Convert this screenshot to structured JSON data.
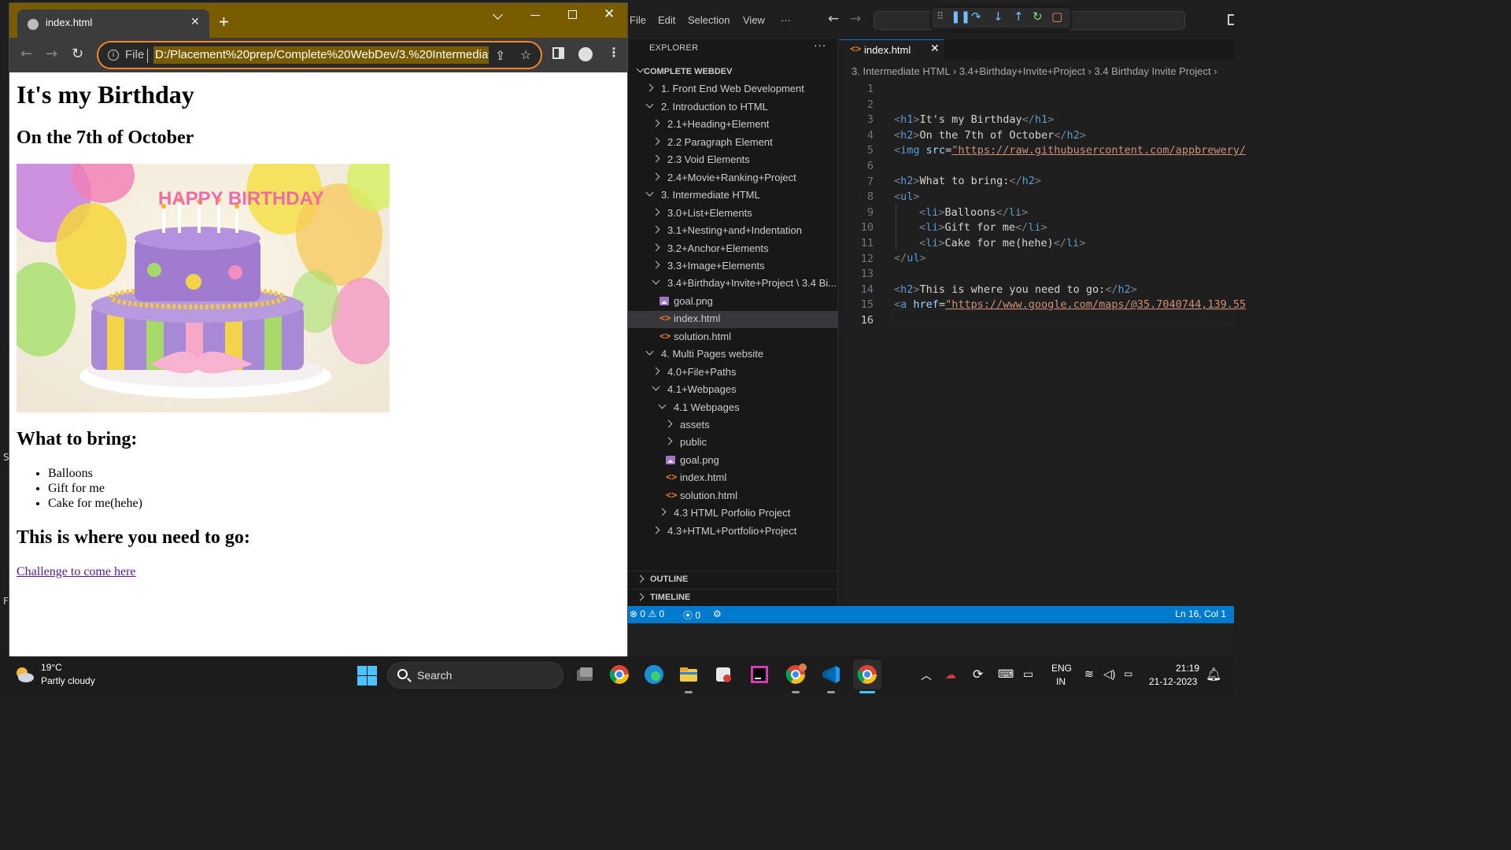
{
  "browser": {
    "tab_title": "index.html",
    "scheme_label": "File",
    "url": "D:/Placement%20prep/Complete%20WebDev/3.%20Intermediate%",
    "accent_color": "#7a5c00",
    "omnibox_focus_color": "#ef8a2c"
  },
  "page": {
    "h1": "It's my Birthday",
    "h2_date": "On the 7th of October",
    "image_alt": "birthday-cake",
    "cake_text": "HAPPY BIRTHDAY",
    "h2_bring": "What to bring:",
    "items": [
      "Balloons",
      "Gift for me",
      "Cake for me(hehe)"
    ],
    "h2_where": "This is where you need to go:",
    "link_text": "Challenge to come here"
  },
  "vscode": {
    "menu": [
      "File",
      "Edit",
      "Selection",
      "View",
      "···"
    ],
    "explorer_title": "EXPLORER",
    "workspace": "COMPLETE WEBDEV",
    "tree": [
      {
        "label": "1. Front End Web Development",
        "type": "folder",
        "open": false
      },
      {
        "label": "2. Introduction to HTML",
        "type": "folder",
        "open": true
      },
      {
        "label": "2.1+Heading+Element",
        "type": "folder",
        "open": false
      },
      {
        "label": "2.2 Paragraph Element",
        "type": "folder",
        "open": false
      },
      {
        "label": "2.3 Void Elements",
        "type": "folder",
        "open": false
      },
      {
        "label": "2.4+Movie+Ranking+Project",
        "type": "folder",
        "open": false
      },
      {
        "label": "3. Intermediate HTML",
        "type": "folder",
        "open": true
      },
      {
        "label": "3.0+List+Elements",
        "type": "folder",
        "open": false
      },
      {
        "label": "3.1+Nesting+and+Indentation",
        "type": "folder",
        "open": false
      },
      {
        "label": "3.2+Anchor+Elements",
        "type": "folder",
        "open": false
      },
      {
        "label": "3.3+Image+Elements",
        "type": "folder",
        "open": false
      },
      {
        "label": "3.4+Birthday+Invite+Project \\ 3.4 Bi...",
        "type": "folder",
        "open": true
      },
      {
        "label": "goal.png",
        "type": "image"
      },
      {
        "label": "index.html",
        "type": "html",
        "selected": true
      },
      {
        "label": "solution.html",
        "type": "html"
      },
      {
        "label": "4. Multi Pages website",
        "type": "folder",
        "open": true
      },
      {
        "label": "4.0+File+Paths",
        "type": "folder",
        "open": false
      },
      {
        "label": "4.1+Webpages",
        "type": "folder",
        "open": true
      },
      {
        "label": "4.1 Webpages",
        "type": "folder",
        "open": true
      },
      {
        "label": "assets",
        "type": "folder",
        "open": false
      },
      {
        "label": "public",
        "type": "folder",
        "open": false
      },
      {
        "label": "goal.png",
        "type": "image"
      },
      {
        "label": "index.html",
        "type": "html"
      },
      {
        "label": "solution.html",
        "type": "html"
      },
      {
        "label": "4.3 HTML Porfolio Project",
        "type": "folder",
        "open": false
      },
      {
        "label": "4.3+HTML+Portfolio+Project",
        "type": "folder",
        "open": false
      }
    ],
    "outline_label": "OUTLINE",
    "timeline_label": "TIMELINE",
    "editor_tab": "index.html",
    "breadcrumb": [
      "3. Intermediate HTML",
      "3.4+Birthday+Invite+Project",
      "3.4 Birthday Invite Project"
    ],
    "line_numbers": [
      "1",
      "2",
      "3",
      "4",
      "5",
      "6",
      "7",
      "8",
      "9",
      "10",
      "11",
      "12",
      "13",
      "14",
      "15",
      "16"
    ],
    "code": {
      "l3_text": "It's my Birthday",
      "l4_text": "On the 7th of October",
      "l5_attr": "src",
      "l5_url": "https://raw.githubusercontent.com/appbrewery/",
      "l7_text": "What to bring:",
      "l9_text": "Balloons",
      "l10_text": "Gift for me",
      "l11_text": "Cake for me(hehe)",
      "l14_text": "This is where you need to go:",
      "l15_attr": "href",
      "l15_url": "https://www.google.com/maps/@35.7040744,139.55"
    },
    "status": {
      "errors": "0",
      "warnings": "0",
      "ports": "0",
      "position": "Ln 16, Col 1"
    }
  },
  "taskbar": {
    "temperature": "19°C",
    "weather": "Partly cloudy",
    "search_label": "Search",
    "lang_top": "ENG",
    "lang_bottom": "IN",
    "time": "21:19",
    "date": "21-12-2023"
  },
  "edge_chars": [
    "S",
    "F"
  ]
}
